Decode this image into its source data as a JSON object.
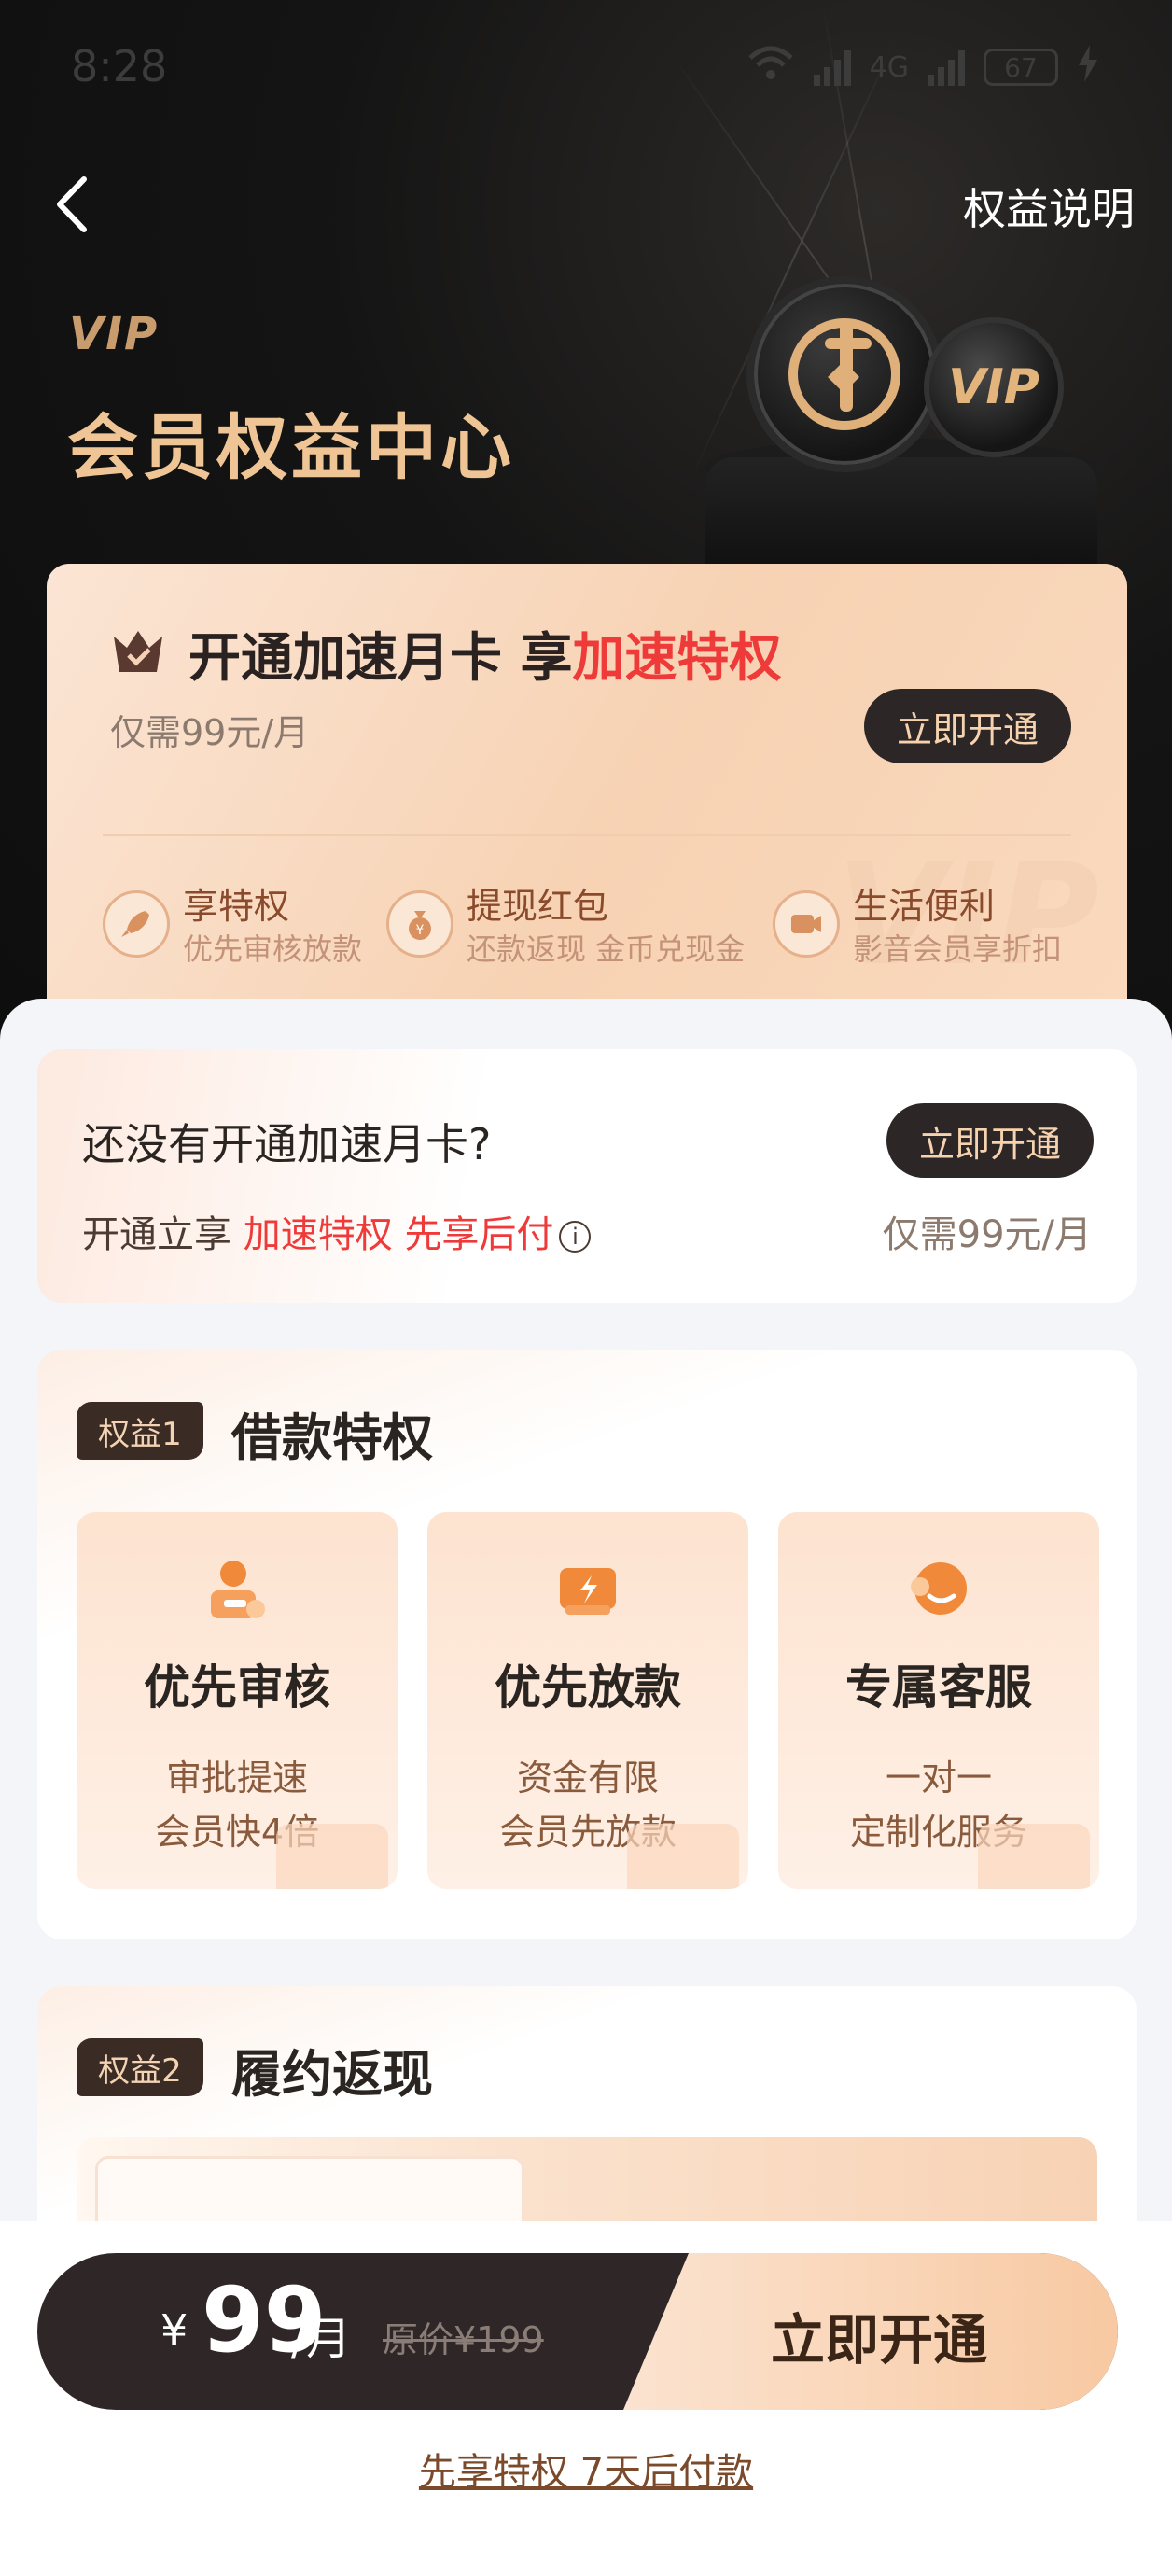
{
  "status_bar": {
    "time": "8:28",
    "network": "4G",
    "wifi_label": "6",
    "battery": "67"
  },
  "header": {
    "rights_link": "权益说明",
    "vip_mark": "VIP",
    "title": "会员权益中心",
    "coin_text": "VIP"
  },
  "member_card": {
    "title_prefix": "开通加速月卡 享",
    "title_highlight": "加速特权",
    "subtitle": "仅需99元/月",
    "button": "立即开通",
    "watermark": "VIP",
    "perks": [
      {
        "title": "享特权",
        "desc": "优先审核放款",
        "icon": "rocket-icon"
      },
      {
        "title": "提现红包",
        "desc": "还款返现 金币兑现金",
        "icon": "money-bag-icon"
      },
      {
        "title": "生活便利",
        "desc": "影音会员享折扣",
        "icon": "video-icon"
      }
    ]
  },
  "notice": {
    "question": "还没有开通加速月卡?",
    "button": "立即开通",
    "line_prefix": "开通立享",
    "hl1": "加速特权",
    "hl2": "先享后付",
    "info_icon": "i",
    "price": "仅需99元/月"
  },
  "benefit1": {
    "tag": "权益1",
    "title": "借款特权",
    "tiles": [
      {
        "name": "优先审核",
        "desc1": "审批提速",
        "desc2": "会员快4倍",
        "icon": "reviewer-icon"
      },
      {
        "name": "优先放款",
        "desc1": "资金有限",
        "desc2": "会员先放款",
        "icon": "ticket-icon"
      },
      {
        "name": "专属客服",
        "desc1": "一对一",
        "desc2": "定制化服务",
        "icon": "chat-icon"
      }
    ]
  },
  "benefit2": {
    "tag": "权益2",
    "title": "履约返现"
  },
  "bottom": {
    "currency": "¥",
    "price": "99",
    "unit": "/月",
    "original": "原价¥199",
    "cta": "立即开通",
    "note": "先享特权 7天后付款"
  },
  "colors": {
    "accent_red": "#ef3a3a",
    "dark_button": "#2c2626",
    "gold_text": "#f0c595"
  }
}
